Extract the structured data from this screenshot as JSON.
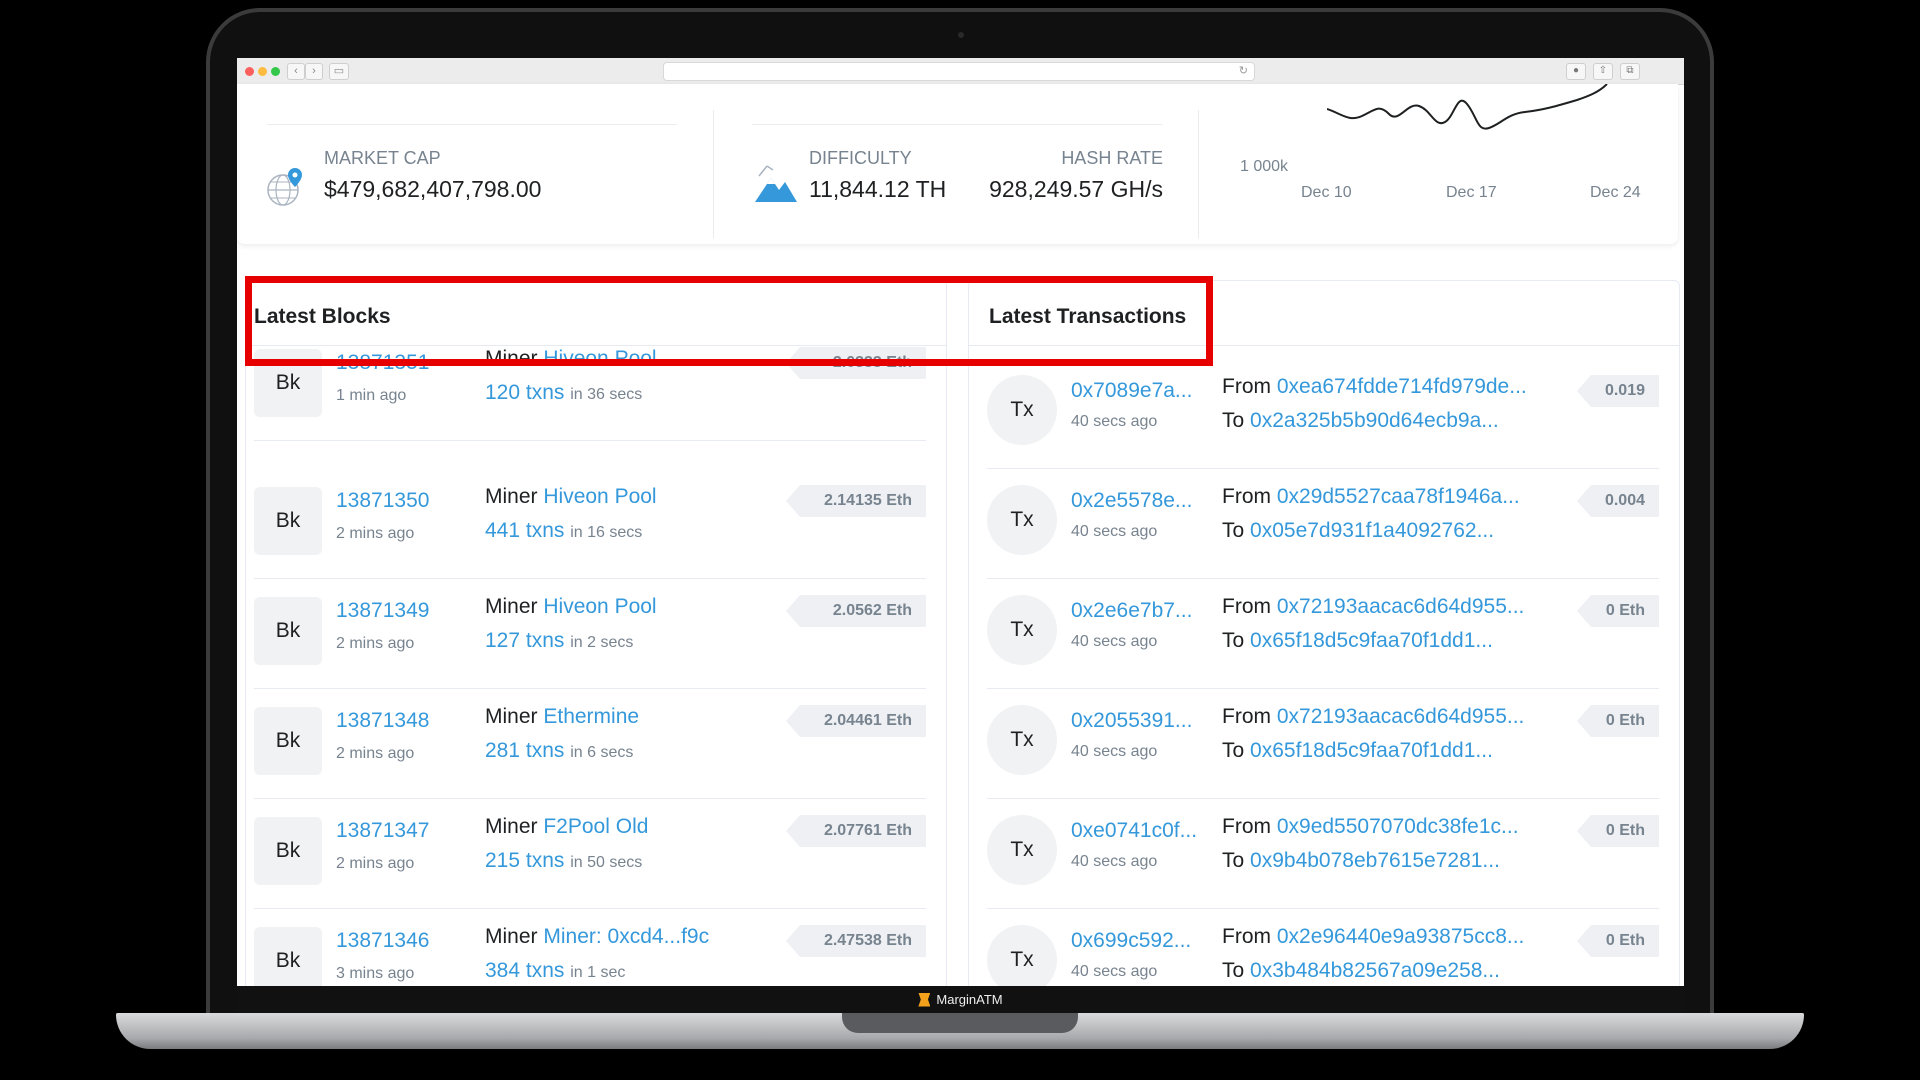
{
  "brand": "MarginATM",
  "stats": {
    "market_cap_label": "MARKET CAP",
    "market_cap_value": "$479,682,407,798.00",
    "difficulty_label": "DIFFICULTY",
    "difficulty_value": "11,844.12 TH",
    "hashrate_label": "HASH RATE",
    "hashrate_value": "928,249.57 GH/s",
    "chart_ytick": "1 000k",
    "chart_xticks": [
      "Dec 10",
      "Dec 17",
      "Dec 24"
    ]
  },
  "latest_blocks": {
    "title": "Latest Blocks",
    "badge": "Bk",
    "miner_prefix": "Miner",
    "rows": [
      {
        "number": "13871351",
        "ago": "1 min ago",
        "miner": "Hiveon Pool",
        "txns": "120 txns",
        "time": "in 36 secs",
        "reward": "2.0333 Eth"
      },
      {
        "number": "13871350",
        "ago": "2 mins ago",
        "miner": "Hiveon Pool",
        "txns": "441 txns",
        "time": "in 16 secs",
        "reward": "2.14135 Eth"
      },
      {
        "number": "13871349",
        "ago": "2 mins ago",
        "miner": "Hiveon Pool",
        "txns": "127 txns",
        "time": "in 2 secs",
        "reward": "2.0562 Eth"
      },
      {
        "number": "13871348",
        "ago": "2 mins ago",
        "miner": "Ethermine",
        "txns": "281 txns",
        "time": "in 6 secs",
        "reward": "2.04461 Eth"
      },
      {
        "number": "13871347",
        "ago": "2 mins ago",
        "miner": "F2Pool Old",
        "txns": "215 txns",
        "time": "in 50 secs",
        "reward": "2.07761 Eth"
      },
      {
        "number": "13871346",
        "ago": "3 mins ago",
        "miner": "Miner: 0xcd4...f9c",
        "txns": "384 txns",
        "time": "in 1 sec",
        "reward": "2.47538 Eth"
      }
    ]
  },
  "latest_transactions": {
    "title": "Latest Transactions",
    "badge": "Tx",
    "from_label": "From",
    "to_label": "To",
    "rows": [
      {
        "hash": "0x7089e7a...",
        "ago": "40 secs ago",
        "from": "0xea674fdde714fd979de...",
        "to": "0x2a325b5b90d64ecb9a...",
        "value": "0.019"
      },
      {
        "hash": "0x2e5578e...",
        "ago": "40 secs ago",
        "from": "0x29d5527caa78f1946a...",
        "to": "0x05e7d931f1a4092762...",
        "value": "0.004"
      },
      {
        "hash": "0x2e6e7b7...",
        "ago": "40 secs ago",
        "from": "0x72193aacac6d64d955...",
        "to": "0x65f18d5c9faa70f1dd1...",
        "value": "0 Eth"
      },
      {
        "hash": "0x2055391...",
        "ago": "40 secs ago",
        "from": "0x72193aacac6d64d955...",
        "to": "0x65f18d5c9faa70f1dd1...",
        "value": "0 Eth"
      },
      {
        "hash": "0xe0741c0f...",
        "ago": "40 secs ago",
        "from": "0x9ed5507070dc38fe1c...",
        "to": "0x9b4b078eb7615e7281...",
        "value": "0 Eth"
      },
      {
        "hash": "0x699c592...",
        "ago": "40 secs ago",
        "from": "0x2e96440e9a93875cc8...",
        "to": "0x3b484b82567a09e258...",
        "value": "0 Eth"
      }
    ]
  },
  "colors": {
    "accent": "#3498db",
    "highlight": "#e60000"
  }
}
